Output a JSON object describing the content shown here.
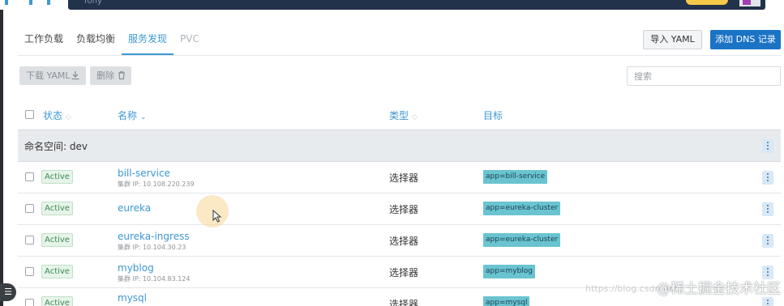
{
  "topbar": {
    "cluster_name": "fony"
  },
  "tabs": [
    {
      "label": "工作负载",
      "state": "normal"
    },
    {
      "label": "负载均衡",
      "state": "normal"
    },
    {
      "label": "服务发现",
      "state": "active"
    },
    {
      "label": "PVC",
      "state": "disabled"
    }
  ],
  "header_buttons": {
    "import": "导入 YAML",
    "add": "添加 DNS 记录"
  },
  "toolbar": {
    "download": "下载 YAML",
    "delete": "删除",
    "search_placeholder": "搜索"
  },
  "table": {
    "columns": {
      "state": "状态",
      "name": "名称",
      "type": "类型",
      "target": "目标"
    },
    "group": {
      "label": "命名空间: dev"
    },
    "rows": [
      {
        "state": "Active",
        "name": "bill-service",
        "cluster_ip": "集群 IP: 10.108.220.239",
        "type": "选择器",
        "target": "app=bill-service"
      },
      {
        "state": "Active",
        "name": "eureka",
        "cluster_ip": "",
        "type": "选择器",
        "target": "app=eureka-cluster"
      },
      {
        "state": "Active",
        "name": "eureka-ingress",
        "cluster_ip": "集群 IP: 10.104.30.23",
        "type": "选择器",
        "target": "app=eureka-cluster"
      },
      {
        "state": "Active",
        "name": "myblog",
        "cluster_ip": "集群 IP: 10.104.83.124",
        "type": "选择器",
        "target": "app=myblog"
      },
      {
        "state": "Active",
        "name": "mysql",
        "cluster_ip": "",
        "type": "选择器",
        "target": "app=mysql"
      }
    ]
  },
  "watermark": {
    "url": "https://blog.csdn.net",
    "brand": "@稀土掘金技术社区"
  },
  "left_badge": "☰"
}
